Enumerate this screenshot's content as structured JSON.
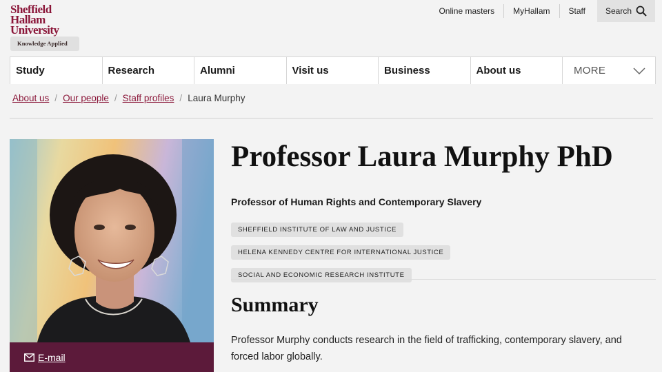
{
  "logo": {
    "line1": "Sheffield",
    "line2": "Hallam",
    "line3": "University",
    "tagline": "Knowledge Applied"
  },
  "utility": {
    "online_masters": "Online masters",
    "myhallam": "MyHallam",
    "staff": "Staff",
    "search": "Search"
  },
  "nav": {
    "items": [
      "Study",
      "Research",
      "Alumni",
      "Visit us",
      "Business",
      "About us"
    ],
    "more": "MORE"
  },
  "breadcrumb": {
    "items": [
      "About us",
      "Our people",
      "Staff profiles"
    ],
    "current": "Laura Murphy"
  },
  "profile": {
    "name": "Professor Laura Murphy PhD",
    "role": "Professor of Human Rights and Contemporary Slavery",
    "tags": [
      "SHEFFIELD INSTITUTE OF LAW AND JUSTICE",
      "HELENA KENNEDY CENTRE FOR INTERNATIONAL JUSTICE",
      "SOCIAL AND ECONOMIC RESEARCH INSTITUTE"
    ],
    "email_label": "E-mail"
  },
  "summary": {
    "heading": "Summary",
    "text": "Professor Murphy conducts research in the field of trafficking, contemporary slavery, and forced labor globally."
  },
  "colors": {
    "brand": "#8a1538",
    "email_bar": "#5c1a3a"
  }
}
